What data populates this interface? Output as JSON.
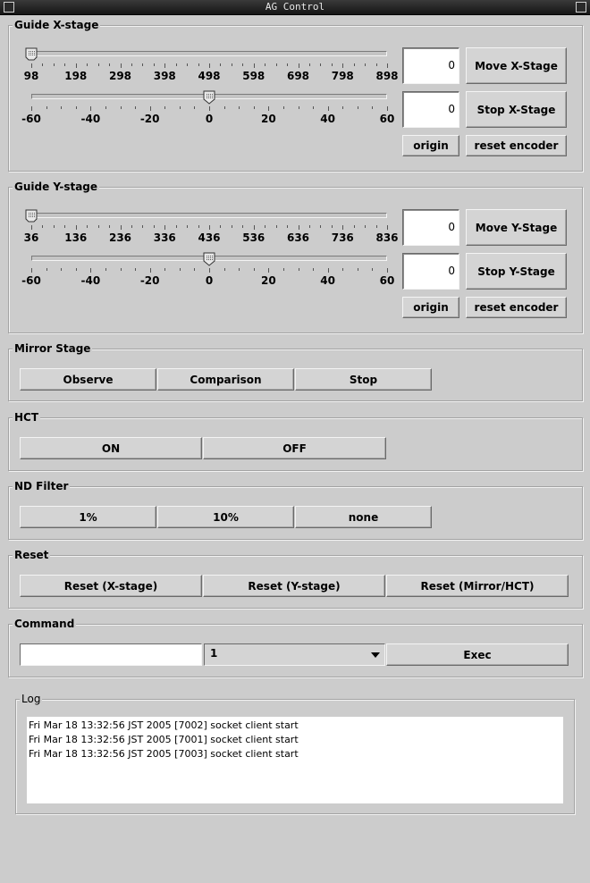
{
  "window": {
    "title": "AG Control"
  },
  "guide_x": {
    "title": "Guide X-stage",
    "coarse_slider": {
      "value": 98,
      "min": 98,
      "max": 898,
      "labels": [
        "98",
        "198",
        "298",
        "398",
        "498",
        "598",
        "698",
        "798",
        "898"
      ]
    },
    "fine_slider": {
      "value": 0,
      "min": -60,
      "max": 60,
      "labels": [
        "-60",
        "-40",
        "-20",
        "0",
        "20",
        "40",
        "60"
      ]
    },
    "move_field": "0",
    "stop_field": "0",
    "move_label": "Move X-Stage",
    "stop_label": "Stop X-Stage",
    "origin_label": "origin",
    "reset_encoder_label": "reset encoder"
  },
  "guide_y": {
    "title": "Guide Y-stage",
    "coarse_slider": {
      "value": 36,
      "min": 36,
      "max": 836,
      "labels": [
        "36",
        "136",
        "236",
        "336",
        "436",
        "536",
        "636",
        "736",
        "836"
      ]
    },
    "fine_slider": {
      "value": 0,
      "min": -60,
      "max": 60,
      "labels": [
        "-60",
        "-40",
        "-20",
        "0",
        "20",
        "40",
        "60"
      ]
    },
    "move_field": "0",
    "stop_field": "0",
    "move_label": "Move Y-Stage",
    "stop_label": "Stop Y-Stage",
    "origin_label": "origin",
    "reset_encoder_label": "reset encoder"
  },
  "mirror": {
    "title": "Mirror Stage",
    "buttons": [
      "Observe",
      "Comparison",
      "Stop"
    ]
  },
  "hct": {
    "title": "HCT",
    "buttons": [
      "ON",
      "OFF"
    ]
  },
  "nd_filter": {
    "title": "ND Filter",
    "buttons": [
      "1%",
      "10%",
      "none"
    ]
  },
  "reset": {
    "title": "Reset",
    "buttons": [
      "Reset (X-stage)",
      "Reset (Y-stage)",
      "Reset (Mirror/HCT)"
    ]
  },
  "command": {
    "title": "Command",
    "input_value": "",
    "selected": "1",
    "exec_label": "Exec"
  },
  "log": {
    "title": "Log",
    "lines": [
      "Fri Mar 18 13:32:56 JST 2005 [7002] socket client start",
      "Fri Mar 18 13:32:56 JST 2005 [7001] socket client start",
      "Fri Mar 18 13:32:56 JST 2005 [7003] socket client start"
    ]
  }
}
